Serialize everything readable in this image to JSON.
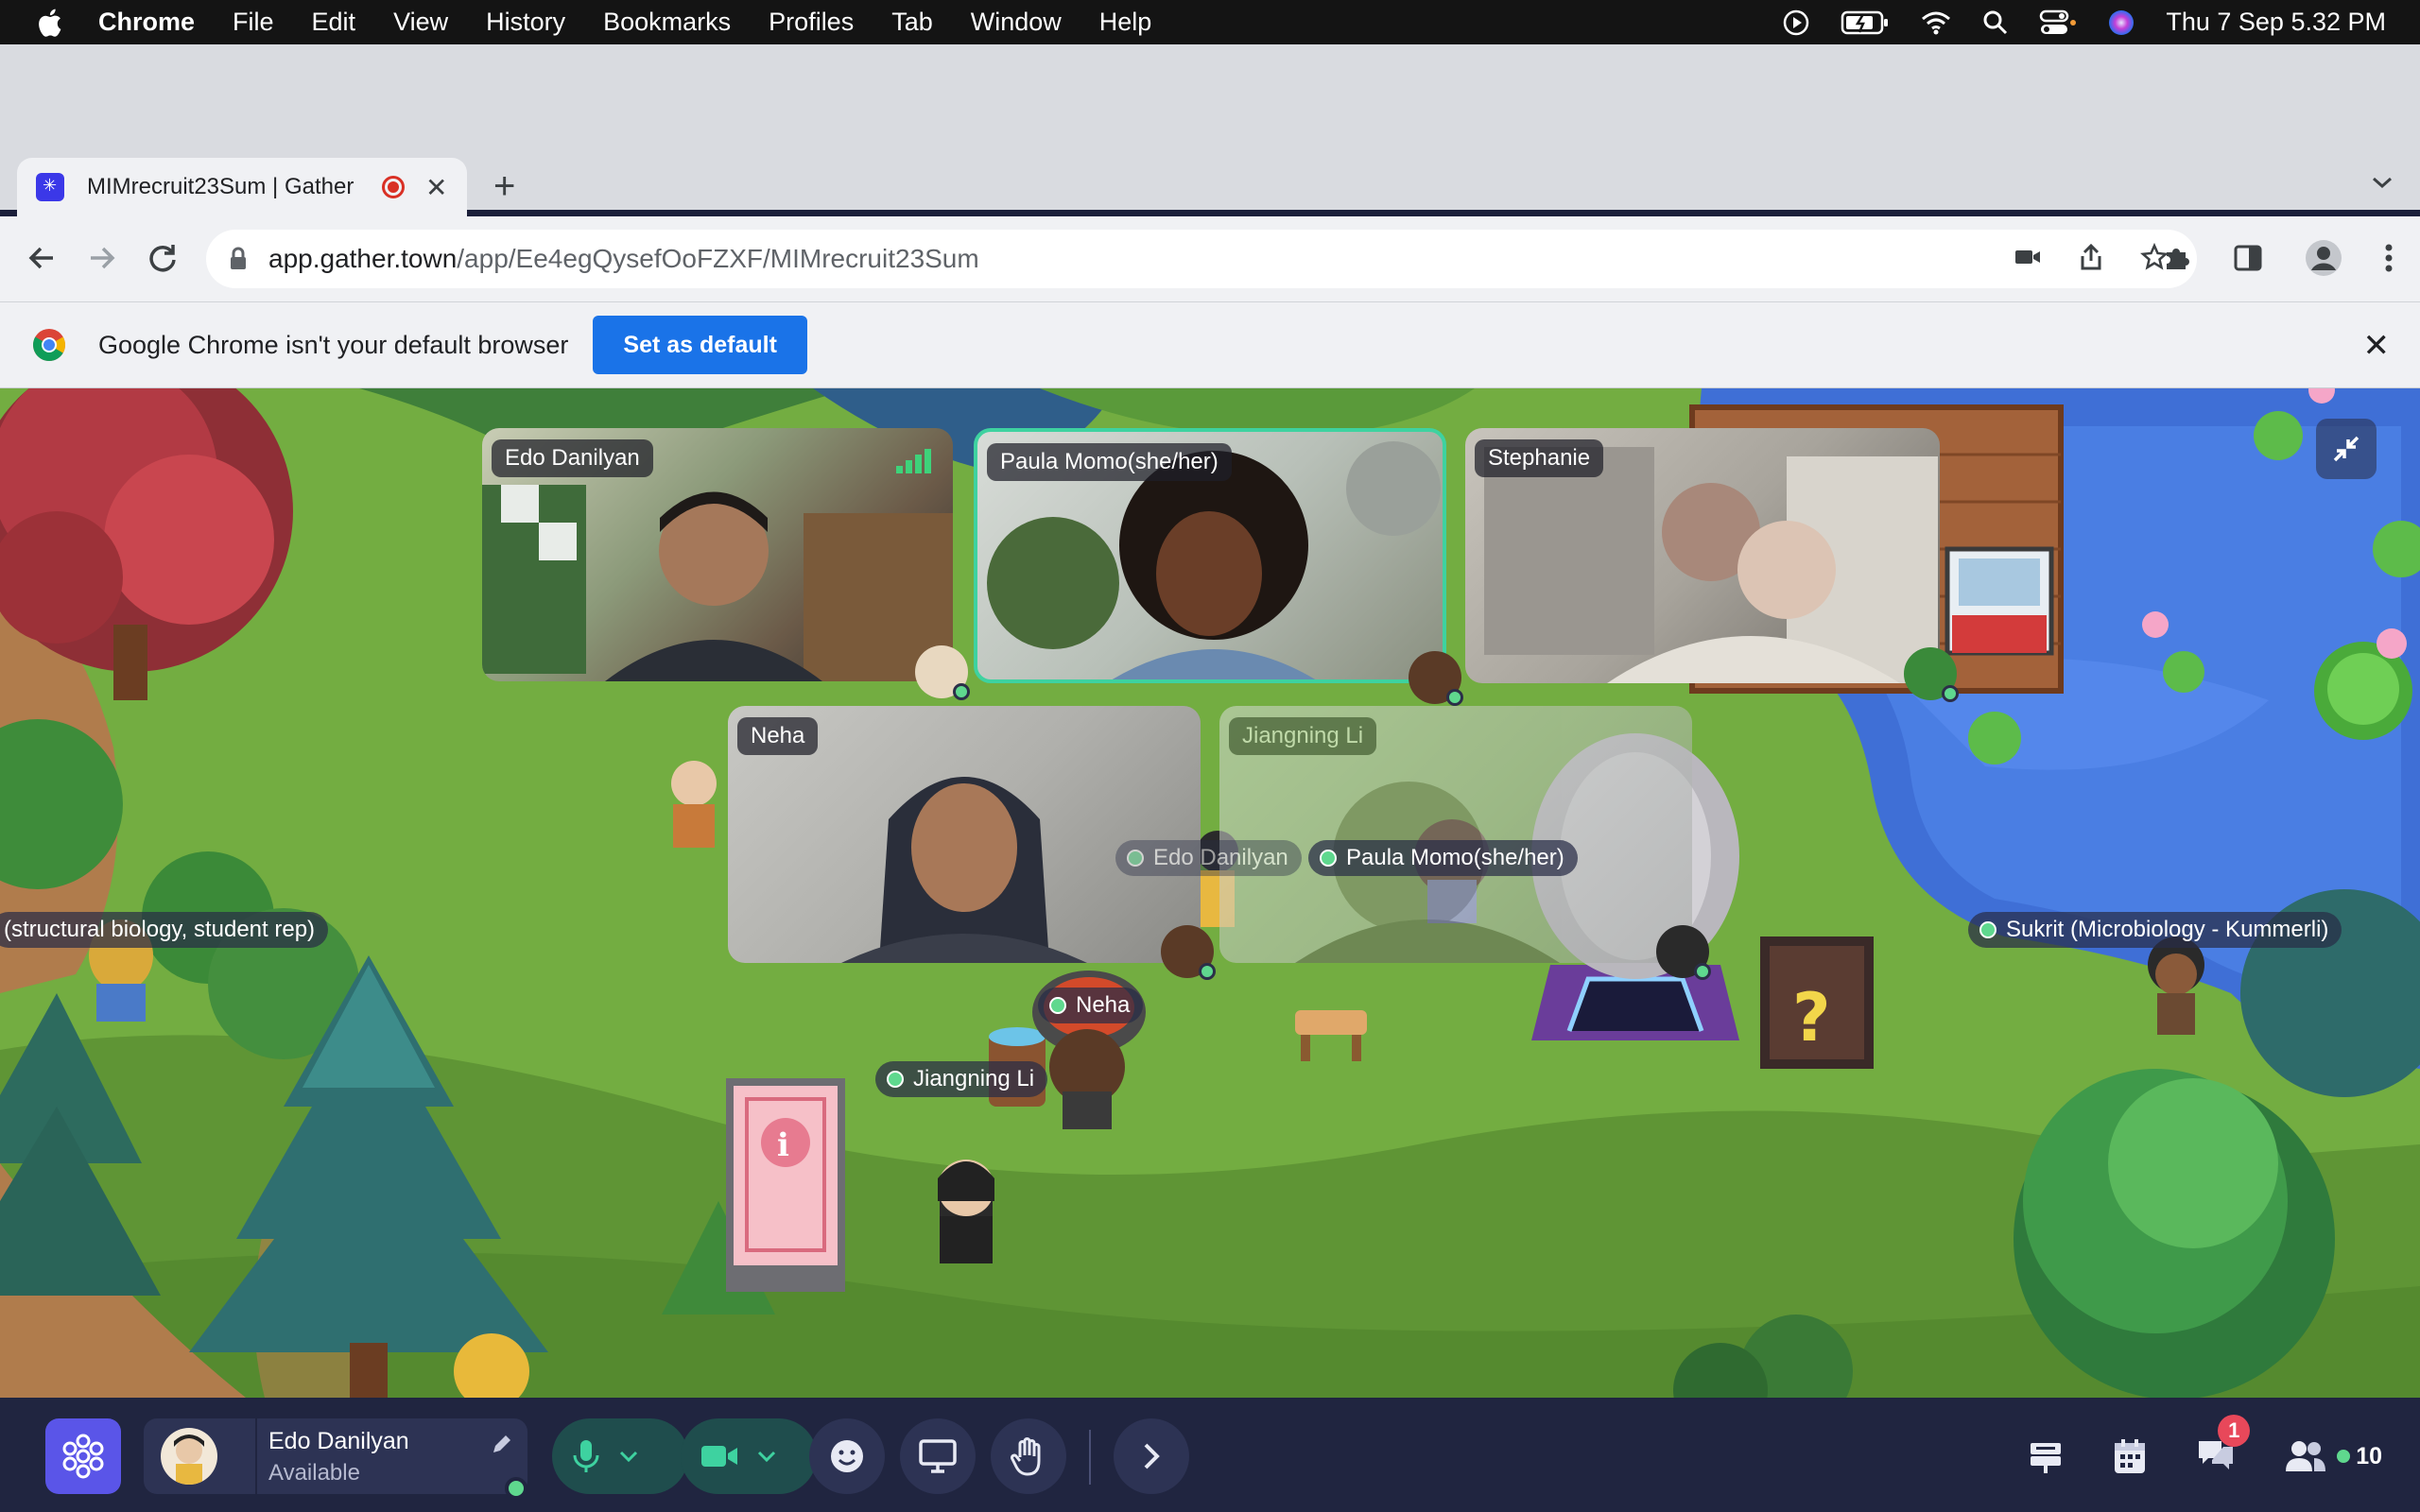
{
  "menubar": {
    "app_name": "Chrome",
    "items": [
      "File",
      "Edit",
      "View",
      "History",
      "Bookmarks",
      "Profiles",
      "Tab",
      "Window",
      "Help"
    ],
    "clock": "Thu 7 Sep  5.32 PM"
  },
  "tab": {
    "title": "MIMrecruit23Sum | Gather"
  },
  "omnibox": {
    "domain": "app.gather.town",
    "path": "/app/Ee4egQysefOoFZXF/MIMrecruit23Sum"
  },
  "infobar": {
    "message": "Google Chrome isn't your default browser",
    "button": "Set as default"
  },
  "videos": [
    {
      "name": "Edo Danilyan"
    },
    {
      "name": "Paula Momo(she/her)"
    },
    {
      "name": "Stephanie"
    },
    {
      "name": "Neha"
    },
    {
      "name": "Jiangning Li"
    }
  ],
  "map_labels": {
    "structural": "(structural biology, student rep)",
    "sukrit": "Sukrit (Microbiology - Kummerli)",
    "neha": "Neha",
    "jiangning": "Jiangning Li",
    "edo": "Edo Danilyan",
    "paula": "Paula Momo(she/her)"
  },
  "bottombar": {
    "user_name": "Edo Danilyan",
    "user_status": "Available",
    "chat_badge": "1",
    "participant_count": "10"
  },
  "colors": {
    "accent": "#5a55e8",
    "online": "#5fd88e",
    "active_speaker": "#3ed2a0",
    "chrome_blue": "#1a73e8"
  }
}
